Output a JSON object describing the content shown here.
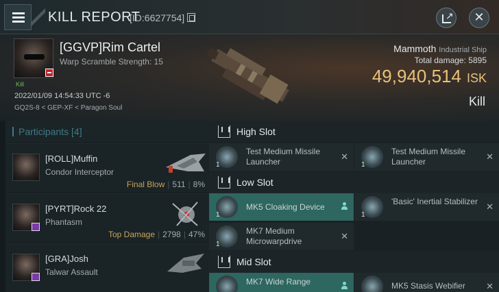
{
  "header": {
    "title": "KILL REPORT",
    "id_text": "[ID:6627754]"
  },
  "victim": {
    "name": "[GGVP]Rim Cartel",
    "subtitle": "Warp Scramble Strength: 15",
    "kill_tag": "Kill",
    "timestamp": "2022/01/09 14:54:33 UTC -6",
    "location": "GQ2S-8 < GEP-XF < Paragon Soul"
  },
  "ship": {
    "name": "Mammoth",
    "type": "Industrial Ship",
    "total_damage_label": "Total damage:",
    "total_damage_value": "5895",
    "isk_value": "49,940,514",
    "isk_unit": "ISK",
    "result": "Kill"
  },
  "participants": {
    "label": "Participants [4]",
    "rows": [
      {
        "name": "[ROLL]Muffin",
        "ship": "Condor Interceptor",
        "tag": "Final Blow",
        "damage": "511",
        "percent": "8%"
      },
      {
        "name": "[PYRT]Rock 22",
        "ship": "Phantasm",
        "tag": "Top Damage",
        "damage": "2798",
        "percent": "47%"
      },
      {
        "name": "[GRA]Josh",
        "ship": "Talwar Assault",
        "tag": "",
        "damage": "",
        "percent": ""
      }
    ]
  },
  "slots": {
    "high": {
      "label": "High Slot",
      "modules": [
        {
          "name": "Test Medium Missile Launcher",
          "qty": "1",
          "status": "destroyed"
        },
        {
          "name": "Test Medium Missile Launcher",
          "qty": "1",
          "status": "destroyed"
        }
      ]
    },
    "low": {
      "label": "Low Slot",
      "modules": [
        {
          "name": "MK5 Cloaking Device",
          "qty": "1",
          "status": "dropped"
        },
        {
          "name": "'Basic' Inertial Stabilizer",
          "qty": "1",
          "status": "destroyed"
        },
        {
          "name": "MK7 Medium Microwarpdrive",
          "qty": "1",
          "status": "destroyed"
        }
      ]
    },
    "mid": {
      "label": "Mid Slot",
      "modules": [
        {
          "name": "MK7 Wide Range",
          "qty": "1",
          "status": "dropped"
        },
        {
          "name": "MK5 Stasis Webifier",
          "qty": "1",
          "status": "destroyed"
        }
      ]
    }
  },
  "colors": {
    "isk": "#e8c27a",
    "accent_teal": "#3f7a86",
    "fitted_bg": "#2e6660",
    "final_blow": "#c9a45a",
    "kill_green": "#6fbf5a",
    "corp_badge": "#7a3aa8",
    "victim_badge": "#c0202a"
  },
  "icons": {
    "menu": "hamburger-icon",
    "copy": "copy-icon",
    "share": "share-icon",
    "close": "close-icon",
    "slot": "slot-icon",
    "dropped": "person-icon",
    "destroyed": "x-icon"
  }
}
